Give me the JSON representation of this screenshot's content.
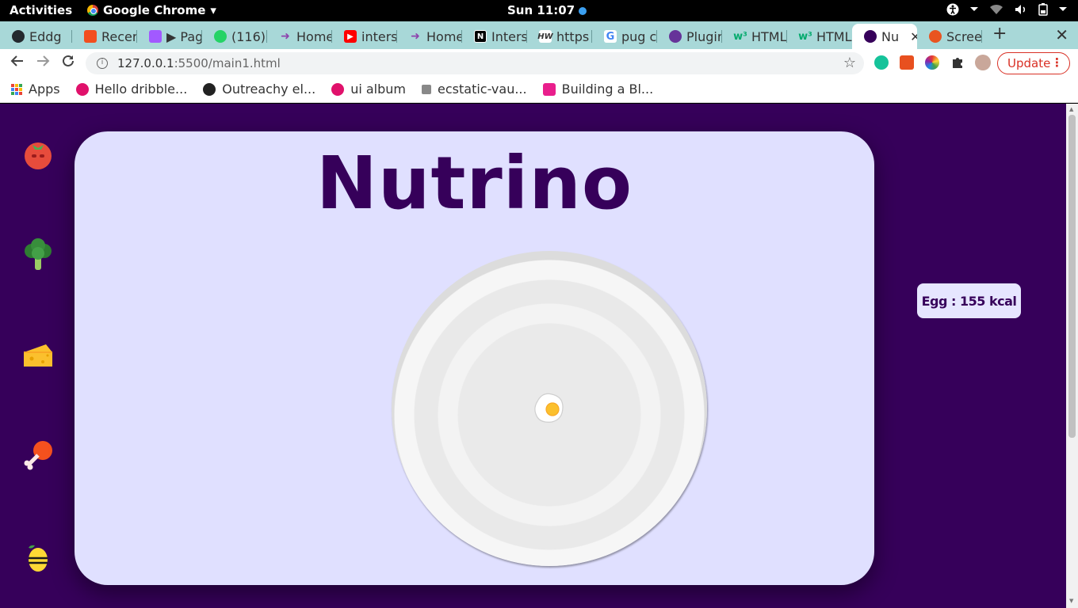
{
  "system_bar": {
    "activities": "Activities",
    "app_name": "Google Chrome",
    "app_menu_arrow": "▾",
    "clock": "Sun 11:07"
  },
  "tabs": [
    {
      "label": "Eddg",
      "icon": "github-icon",
      "color": "#24292e"
    },
    {
      "label": "Recer",
      "icon": "figma-icon",
      "color": "#f24e1e"
    },
    {
      "label": "▶ Pag",
      "icon": "figma-icon",
      "color": "#a259ff"
    },
    {
      "label": "(116)",
      "icon": "whatsapp-icon",
      "color": "#25d366"
    },
    {
      "label": "Home",
      "icon": "arrow-icon",
      "color": "#8e44ad"
    },
    {
      "label": "inters",
      "icon": "youtube-icon",
      "color": "#ff0000"
    },
    {
      "label": "Home",
      "icon": "arrow-icon",
      "color": "#8e44ad"
    },
    {
      "label": "Inters",
      "icon": "notion-icon",
      "color": "#000000"
    },
    {
      "label": "https",
      "icon": "hw-icon",
      "color": "#333333"
    },
    {
      "label": "pug c",
      "icon": "google-icon",
      "color": "#4285f4"
    },
    {
      "label": "Plugir",
      "icon": "gatsby-icon",
      "color": "#663399"
    },
    {
      "label": "HTML",
      "icon": "w3schools-icon",
      "color": "#04aa6d"
    },
    {
      "label": "HTML",
      "icon": "w3schools-icon",
      "color": "#04aa6d"
    },
    {
      "label": "Nu",
      "icon": "nutrino-icon",
      "color": "#36005a",
      "active": true
    },
    {
      "label": "Scree",
      "icon": "ubuntu-icon",
      "color": "#e95420"
    }
  ],
  "new_tab": "+",
  "strip_close": "✕",
  "tab_close": "✕",
  "address": {
    "host": "127.0.0.1",
    "path": ":5500/main1.html"
  },
  "update_button": "Update",
  "bookmarks": {
    "apps": "Apps",
    "items": [
      {
        "label": "Hello dribble...",
        "color": "#ea4c89"
      },
      {
        "label": "Outreachy el...",
        "color": "#333333"
      },
      {
        "label": "ui album",
        "color": "#ea4c89"
      },
      {
        "label": "ecstatic-vau...",
        "color": "#666666"
      },
      {
        "label": "Building a Bl...",
        "color": "#e91e8c"
      }
    ]
  },
  "page": {
    "title": "Nutrino",
    "food_info": "Egg : 155 kcal",
    "sidebar_foods": [
      "tomato",
      "broccoli",
      "cheese",
      "chicken-leg",
      "lemon"
    ],
    "plate_item": "egg"
  },
  "colors": {
    "page_background": "#36005a",
    "card_background": "#e0e0ff",
    "accent": "#36005a"
  }
}
